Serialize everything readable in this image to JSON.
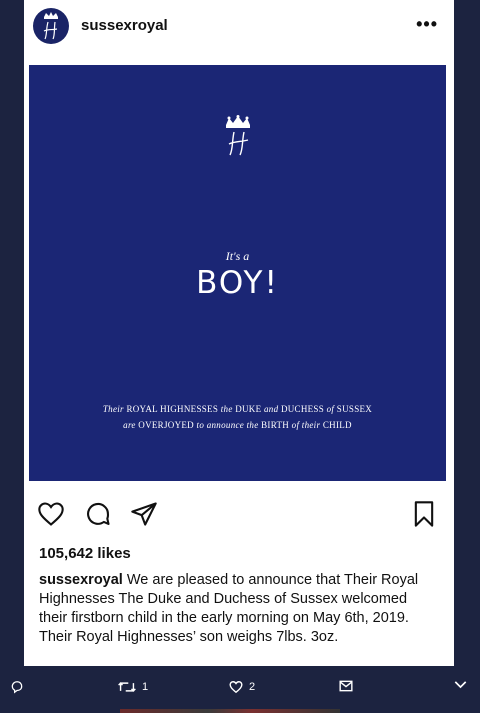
{
  "post": {
    "username": "sussexroyal",
    "more": "•••"
  },
  "image": {
    "its_a": "It's a",
    "boy": "BOY!",
    "line1": {
      "a": "Their",
      "b": "ROYAL HIGHNESSES",
      "c": "the",
      "d": "DUKE",
      "e": "and",
      "f": "DUCHESS",
      "g": "of",
      "h": "SUSSEX"
    },
    "line2": {
      "a": "are",
      "b": "OVERJOYED",
      "c": "to announce the",
      "d": "BIRTH",
      "e": "of their",
      "f": "CHILD"
    }
  },
  "likes": "105,642 likes",
  "caption": {
    "user": "sussexroyal",
    "text": " We are pleased to announce that Their Royal Highnesses The Duke and Duchess of Sussex welcomed their firstborn child in the early morning on May 6th, 2019. Their Royal Highnesses’ son weighs 7lbs. 3oz."
  },
  "bottom_bar": {
    "retweet_count": "1",
    "like_count": "2"
  },
  "colors": {
    "page_bg": "#1c2340",
    "announcement_bg": "#1b2675",
    "card_bg": "#ffffff"
  }
}
